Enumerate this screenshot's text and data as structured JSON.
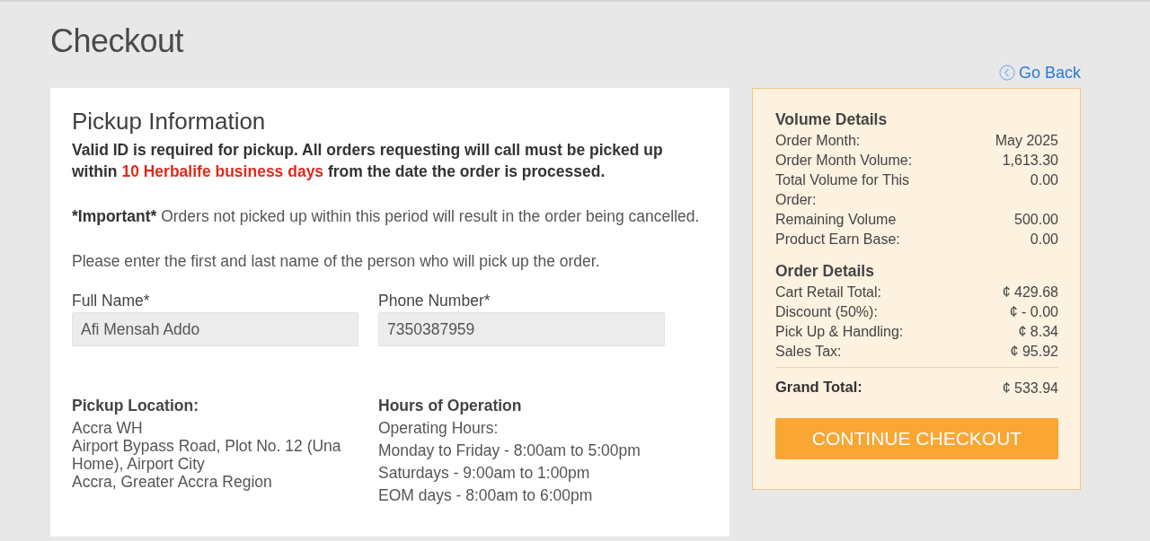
{
  "page_title": "Checkout",
  "go_back": "Go Back",
  "pickup": {
    "title": "Pickup Information",
    "notice": {
      "before": "Valid ID is required for pickup. All orders requesting will call must be picked up within ",
      "highlight": "10 Herbalife business days",
      "after": " from the date the order is processed."
    },
    "important": {
      "label": "*Important*",
      "text": " Orders not picked up within this period will result in the order being cancelled."
    },
    "instruction": "Please enter the first and last name of the person who will pick up the order.",
    "fields": [
      {
        "label": "Full Name*",
        "value": "Afi Mensah Addo"
      },
      {
        "label": "Phone Number*",
        "value": "7350387959"
      }
    ],
    "location": {
      "title": "Pickup Location:",
      "lines": [
        "Accra WH",
        "Airport Bypass Road, Plot No. 12 (Una Home), Airport City",
        "Accra, Greater Accra Region"
      ]
    },
    "hours": {
      "title": "Hours of Operation",
      "lines": [
        "Operating Hours:",
        "Monday to Friday - 8:00am to 5:00pm",
        "Saturdays - 9:00am to 1:00pm",
        "EOM days - 8:00am to 6:00pm"
      ]
    }
  },
  "summary": {
    "sections": [
      {
        "title": "Volume Details",
        "rows": [
          {
            "label": "Order Month:",
            "value": "May 2025"
          },
          {
            "label": "Order Month Volume:",
            "value": "1,613.30"
          },
          {
            "label": "Total Volume for This Order:",
            "value": "0.00"
          },
          {
            "label": "Remaining Volume",
            "value": "500.00"
          },
          {
            "label": "Product Earn Base:",
            "value": "0.00"
          }
        ]
      },
      {
        "title": "Order Details",
        "rows": [
          {
            "label": "Cart Retail Total:",
            "value": "¢ 429.68"
          },
          {
            "label": "Discount (50%):",
            "value": "¢ - 0.00"
          },
          {
            "label": "Pick Up & Handling:",
            "value": "¢ 8.34"
          },
          {
            "label": "Sales Tax:",
            "value": "¢ 95.92"
          }
        ]
      }
    ],
    "grand_total": {
      "label": "Grand Total:",
      "value": "¢ 533.94"
    },
    "button": "CONTINUE CHECKOUT"
  }
}
